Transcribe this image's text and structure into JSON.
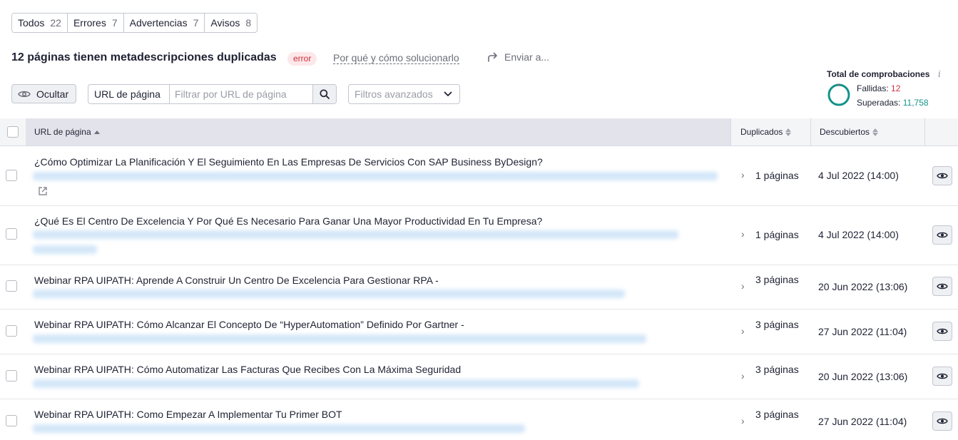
{
  "filters": {
    "tabs": [
      {
        "label": "Todos",
        "count": "22"
      },
      {
        "label": "Errores",
        "count": "7"
      },
      {
        "label": "Advertencias",
        "count": "7"
      },
      {
        "label": "Avisos",
        "count": "8"
      }
    ]
  },
  "issue": {
    "title": "12 páginas tienen metadescripciones duplicadas",
    "badge": "error",
    "why_link": "Por qué y cómo solucionarlo",
    "send": "Enviar a..."
  },
  "checks": {
    "title": "Total de comprobaciones",
    "failed_label": "Fallidas:",
    "failed_value": "12",
    "passed_label": "Superadas:",
    "passed_value": "11,758",
    "colors": {
      "failed": "#d1323c",
      "passed": "#14938a"
    }
  },
  "toolbar": {
    "hide_label": "Ocultar",
    "url_label": "URL de página",
    "url_placeholder": "Filtrar por URL de página",
    "advanced_filters": "Filtros avanzados"
  },
  "table": {
    "columns": {
      "url": "URL de página",
      "duplicates": "Duplicados",
      "discovered": "Descubiertos"
    },
    "rows": [
      {
        "title": "¿Cómo Optimizar La Planificación Y El Seguimiento En Las Empresas De Servicios Con SAP Business ByDesign?",
        "duplicates": "1 páginas",
        "discovered": "4 Jul 2022 (14:00)"
      },
      {
        "title": "¿Qué Es El Centro De Excelencia Y Por Qué Es Necesario Para Ganar Una Mayor Productividad En Tu Empresa?",
        "duplicates": "1 páginas",
        "discovered": "4 Jul 2022 (14:00)"
      },
      {
        "title": "Webinar RPA UIPATH: Aprende A Construir Un Centro De Excelencia Para Gestionar RPA -",
        "duplicates": "3 páginas",
        "discovered": "20 Jun 2022 (13:06)"
      },
      {
        "title": "Webinar RPA UIPATH: Cómo Alcanzar El Concepto De “HyperAutomation” Definido Por Gartner -",
        "duplicates": "3 páginas",
        "discovered": "27 Jun 2022 (11:04)"
      },
      {
        "title": "Webinar RPA UIPATH: Cómo Automatizar Las Facturas Que Recibes Con La Máxima Seguridad",
        "duplicates": "3 páginas",
        "discovered": "20 Jun 2022 (13:06)"
      },
      {
        "title": "Webinar RPA UIPATH: Como Empezar A Implementar Tu Primer BOT",
        "duplicates": "3 páginas",
        "discovered": "27 Jun 2022 (11:04)"
      }
    ]
  }
}
